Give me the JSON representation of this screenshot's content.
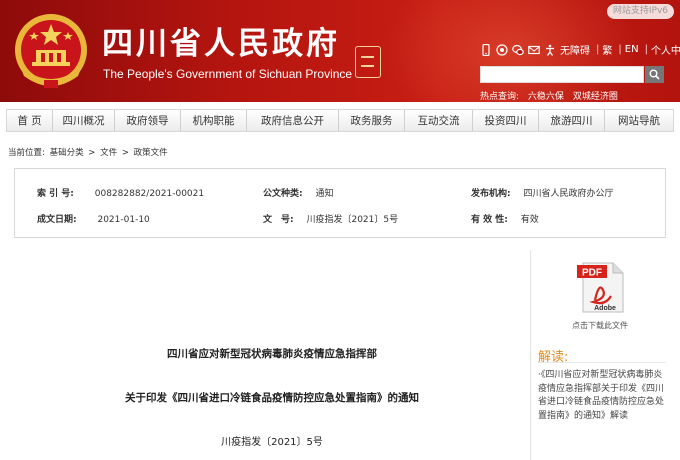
{
  "header": {
    "ipv6_badge": "网站支持IPv6",
    "title_cn": "四川省人民政府",
    "title_en": "The People's Government of Sichuan Province",
    "tools": {
      "accessible": "无障碍",
      "traditional": "繁",
      "english": "EN",
      "personal_center": "个人中心",
      "separator": "|"
    },
    "search": {
      "placeholder": ""
    },
    "hot": {
      "label": "热点查询:",
      "items": [
        "六稳六保",
        "双城经济圈"
      ]
    }
  },
  "nav": {
    "items": [
      "首 页",
      "四川概况",
      "政府领导",
      "机构职能",
      "政府信息公开",
      "政务服务",
      "互动交流",
      "投资四川",
      "旅游四川",
      "网站导航"
    ]
  },
  "breadcrumb": {
    "label": "当前位置:",
    "items": [
      "基础分类",
      "文件",
      "政策文件"
    ],
    "separator": ">"
  },
  "meta": {
    "index_label": "索 引 号:",
    "index_value": "008282882/2021-00021",
    "type_label": "公文种类:",
    "type_value": "通知",
    "publisher_label": "发布机构:",
    "publisher_value": "四川省人民政府办公厅",
    "date_label": "成文日期:",
    "date_value": "2021-01-10",
    "docno_label": "文　号:",
    "docno_value": "川疫指发〔2021〕5号",
    "validity_label": "有 效 性:",
    "validity_value": "有效"
  },
  "document": {
    "issuer": "四川省应对新型冠状病毒肺炎疫情应急指挥部",
    "title": "关于印发《四川省进口冷链食品疫情防控应急处置指南》的通知",
    "doc_number": "川疫指发〔2021〕5号"
  },
  "sidebar": {
    "pdf_badge": "PDF",
    "pdf_brand": "Adobe",
    "download_label": "点击下载此文件",
    "jiedu_title": "解读:",
    "jiedu_text": "·《四川省应对新型冠状病毒肺炎疫情应急指挥部关于印发《四川省进口冷链食品疫情防控应急处置指南》的通知》解读"
  },
  "colors": {
    "header_red": "#b5150f",
    "jiedu_orange": "#e08b1e",
    "pdf_red": "#d6241c"
  }
}
